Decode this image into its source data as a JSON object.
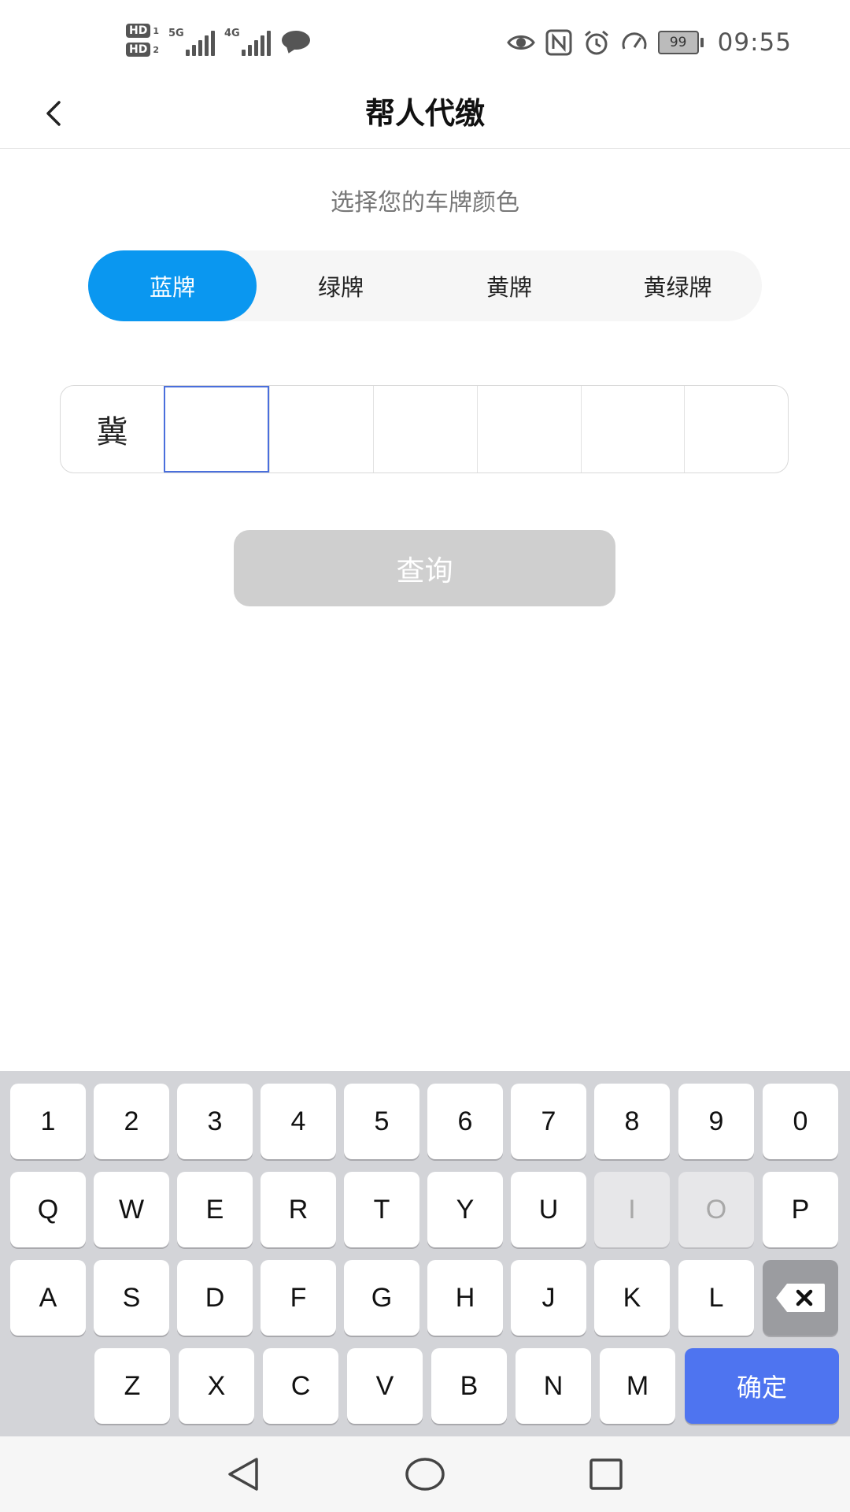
{
  "status_bar": {
    "sim1": "HD",
    "sim1_num": "1",
    "sim2": "HD",
    "sim2_num": "2",
    "net1": "5G",
    "net2": "4G",
    "battery": "99",
    "time": "09:55",
    "icons": [
      "eye-icon",
      "nfc-icon",
      "alarm-icon",
      "speed-icon",
      "battery-icon"
    ]
  },
  "header": {
    "title": "帮人代缴",
    "back_icon": "chevron-left-icon"
  },
  "content": {
    "subtitle": "选择您的车牌颜色",
    "plate_colors": [
      {
        "label": "蓝牌",
        "selected": true
      },
      {
        "label": "绿牌",
        "selected": false
      },
      {
        "label": "黄牌",
        "selected": false
      },
      {
        "label": "黄绿牌",
        "selected": false
      }
    ],
    "plate": {
      "province": "冀",
      "chars": [
        "",
        "",
        "",
        "",
        "",
        ""
      ],
      "focused_index": 0
    },
    "query_label": "查询",
    "accent_color": "#0A97F0"
  },
  "keyboard": {
    "row1": [
      "1",
      "2",
      "3",
      "4",
      "5",
      "6",
      "7",
      "8",
      "9",
      "0"
    ],
    "row2": [
      "Q",
      "W",
      "E",
      "R",
      "T",
      "Y",
      "U",
      "I",
      "O",
      "P"
    ],
    "row3": [
      "A",
      "S",
      "D",
      "F",
      "G",
      "H",
      "J",
      "K",
      "L"
    ],
    "row4": [
      "Z",
      "X",
      "C",
      "V",
      "B",
      "N",
      "M"
    ],
    "disabled_keys": [
      "I",
      "O"
    ],
    "delete_icon": "backspace-icon",
    "confirm_label": "确定",
    "confirm_color": "#4E74F0"
  },
  "nav_bar": {
    "icons": [
      "nav-back-icon",
      "nav-home-icon",
      "nav-recents-icon"
    ]
  }
}
